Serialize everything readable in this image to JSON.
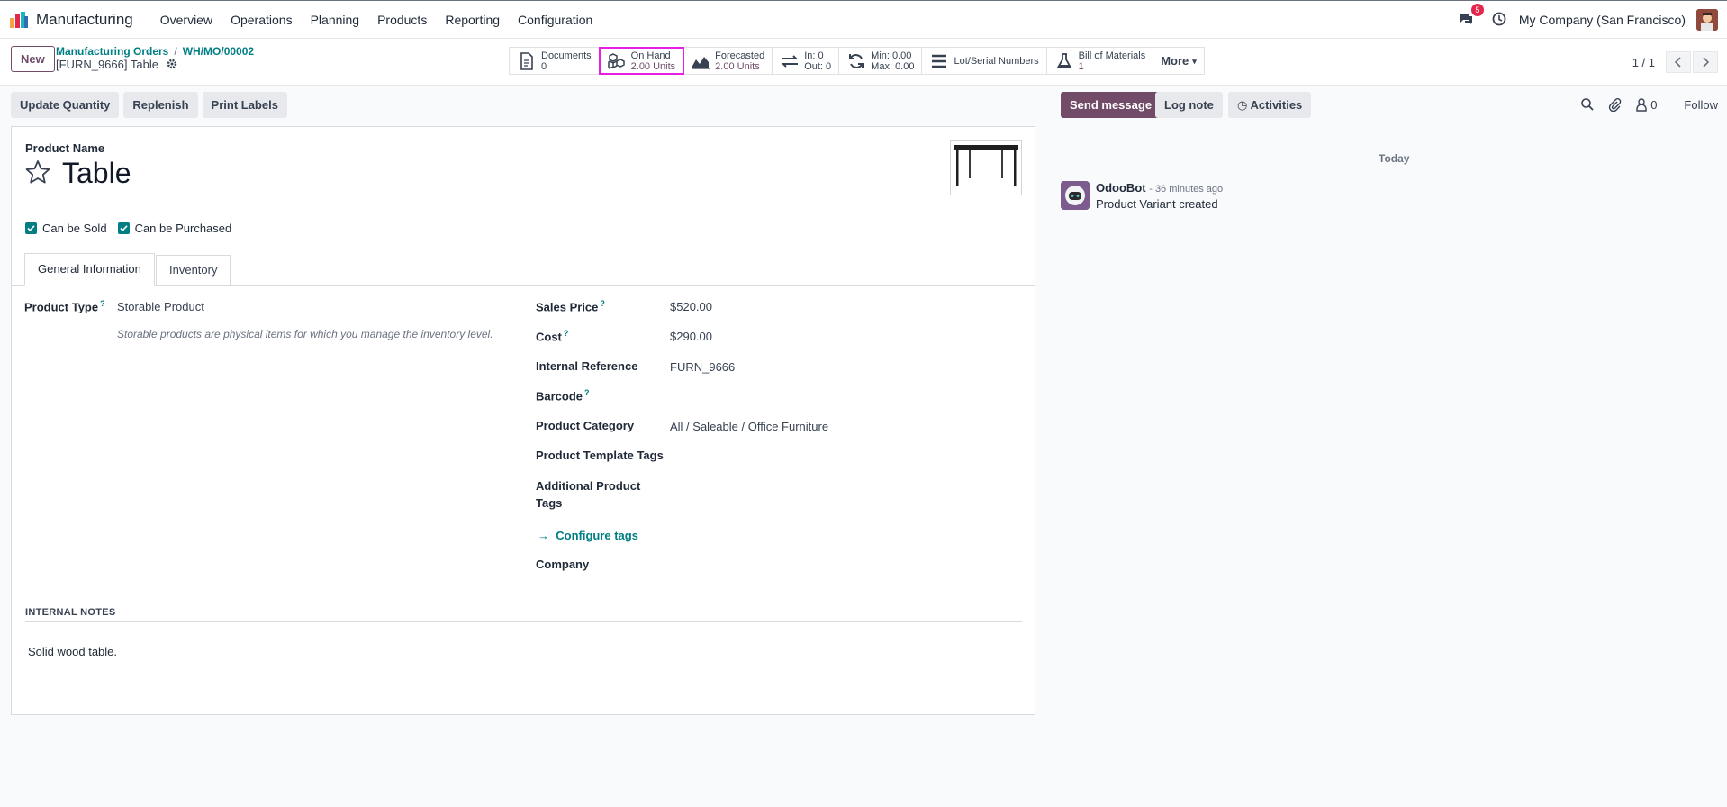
{
  "navbar": {
    "app_name": "Manufacturing",
    "menu": [
      "Overview",
      "Operations",
      "Planning",
      "Products",
      "Reporting",
      "Configuration"
    ],
    "messages_badge": "5",
    "company": "My Company (San Francisco)"
  },
  "control_panel": {
    "new_label": "New",
    "breadcrumb": [
      "Manufacturing Orders",
      "WH/MO/00002"
    ],
    "record_title": "[FURN_9666] Table",
    "smart_buttons": {
      "documents": {
        "label": "Documents",
        "value": "0"
      },
      "on_hand": {
        "label": "On Hand",
        "value": "2.00 Units"
      },
      "forecasted": {
        "label": "Forecasted",
        "value": "2.00 Units"
      },
      "in_out": {
        "in": "In: 0",
        "out": "Out: 0"
      },
      "min_max": {
        "min": "Min: 0.00",
        "max": "Max: 0.00"
      },
      "lots": {
        "label": "Lot/Serial Numbers"
      },
      "bom": {
        "label": "Bill of Materials",
        "value": "1"
      },
      "more": "More"
    },
    "pager": "1 / 1"
  },
  "actions": [
    "Update Quantity",
    "Replenish",
    "Print Labels"
  ],
  "form": {
    "product_name_label": "Product Name",
    "product_name": "Table",
    "can_be_sold": "Can be Sold",
    "can_be_purchased": "Can be Purchased",
    "tabs": [
      "General Information",
      "Inventory"
    ],
    "product_type_label": "Product Type",
    "product_type": "Storable Product",
    "product_type_help": "Storable products are physical items for which you manage the inventory level.",
    "sales_price_label": "Sales Price",
    "sales_price": "$520.00",
    "cost_label": "Cost",
    "cost": "$290.00",
    "internal_reference_label": "Internal Reference",
    "internal_reference": "FURN_9666",
    "barcode_label": "Barcode",
    "product_category_label": "Product Category",
    "product_category": "All / Saleable / Office Furniture",
    "template_tags_label": "Product Template Tags",
    "additional_tags_label_1": "Additional Product",
    "additional_tags_label_2": "Tags",
    "configure_tags": "Configure tags",
    "company_label": "Company",
    "internal_notes_title": "INTERNAL NOTES",
    "internal_notes": "Solid wood table."
  },
  "chatter": {
    "send_message": "Send message",
    "log_note": "Log note",
    "activities": "Activities",
    "followers": "0",
    "follow": "Follow",
    "date_separator": "Today",
    "message": {
      "author": "OdooBot",
      "time": "- 36 minutes ago",
      "body": "Product Variant created"
    }
  },
  "colors": {
    "brand": "#714b67",
    "accent": "#017e84",
    "highlight": "#e81ee5",
    "badge": "#e4264a"
  }
}
